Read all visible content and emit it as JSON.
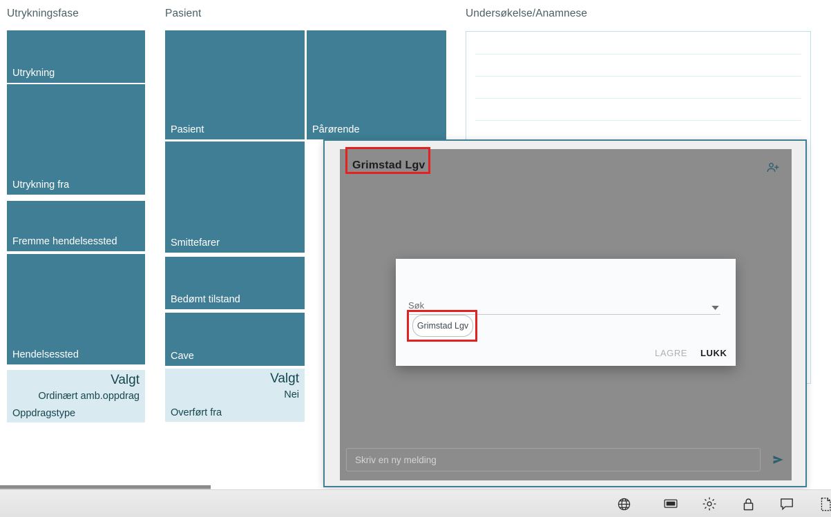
{
  "columns": [
    {
      "heading": "Utrykningsfase",
      "tiles": [
        {
          "label": "Utrykning"
        },
        {
          "label": "Utrykning fra"
        },
        {
          "label": "Fremme hendelsessted"
        },
        {
          "label": "Hendelsessted"
        }
      ],
      "selected": {
        "title": "Valgt",
        "value": "Ordinært amb.oppdrag",
        "label": "Oppdragstype"
      }
    },
    {
      "heading": "Pasient",
      "tiles": [
        {
          "label": "Pasient"
        },
        {
          "label": "Pårørende"
        },
        {
          "label": "Smittefarer"
        },
        {
          "label": "Bedømt tilstand"
        },
        {
          "label": "Cave"
        }
      ],
      "selected": {
        "title": "Valgt",
        "value": "Nei",
        "label": "Overført fra"
      }
    },
    {
      "heading": "Undersøkelse/Anamnese",
      "notes_value": ""
    }
  ],
  "chat": {
    "title": "Grimstad Lgv",
    "add_person_icon": "person-add-icon",
    "composer": {
      "placeholder": "Skriv en ny melding",
      "value": "",
      "send_icon": "send-icon"
    }
  },
  "dialog": {
    "search_label": "Søk",
    "search_value": "",
    "dropdown_icon": "chevron-down-icon",
    "chip_label": "Grimstad Lgv",
    "save_label": "LAGRE",
    "close_label": "LUKK"
  },
  "taskbar": {
    "icons": [
      {
        "name": "globe-icon"
      },
      {
        "name": "monitor-icon"
      },
      {
        "name": "gear-icon"
      },
      {
        "name": "lock-icon"
      },
      {
        "name": "chat-bubble-icon"
      },
      {
        "name": "document-icon"
      }
    ]
  },
  "colors": {
    "tile_teal": "#3f7e94",
    "tile_selected": "#d9ebf0",
    "heading_text": "#4c5f68",
    "highlight_red": "#e52020",
    "chat_backdrop": "#8c8c8c"
  }
}
